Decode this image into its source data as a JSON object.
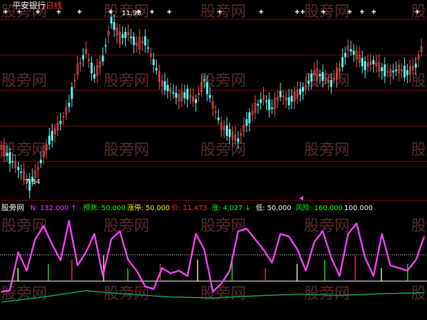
{
  "header": {
    "stock_name": "平安银行",
    "period": "日线",
    "name_color": "#ffffff",
    "period_color": "#ff3333"
  },
  "watermark": {
    "text": "股旁网",
    "color": "#5a2a2a"
  },
  "price_panel": {
    "high_label": "11.98",
    "low_label": "7.34",
    "grid_color": "#8b0000",
    "up_color": "#ff5252",
    "down_color": "#54fcfc"
  },
  "indicator_panel": {
    "name": "股旁网",
    "readout": [
      {
        "label": "N:",
        "value": "132.000",
        "arrow": "↑",
        "color": "#ff40ff"
      },
      {
        "label": "预测:",
        "value": "50.000",
        "arrow": "",
        "color": "#00ff00"
      },
      {
        "label": "涨停:",
        "value": "50.000",
        "arrow": "",
        "color": "#ffff00"
      },
      {
        "label": "价:",
        "value": "11.473",
        "arrow": "",
        "color": "#ff3030"
      },
      {
        "label": "涨:",
        "value": "4.027",
        "arrow": "↓",
        "color": "#00ff00"
      },
      {
        "label": "低:",
        "value": "50.000",
        "arrow": "",
        "color": "#ffffff"
      },
      {
        "label": "风险:",
        "value": "160.000",
        "arrow": "",
        "color": "#00ff00"
      },
      {
        "label": "",
        "value": "100.000",
        "arrow": "",
        "color": "#ffffff"
      }
    ]
  },
  "chart_data": {
    "type": "line",
    "price": {
      "ylim": [
        7.0,
        12.2
      ],
      "series": [
        {
          "x": 0,
          "y": 8.4
        },
        {
          "x": 4,
          "y": 8.0
        },
        {
          "x": 8,
          "y": 7.6
        },
        {
          "x": 10,
          "y": 7.34
        },
        {
          "x": 13,
          "y": 7.8
        },
        {
          "x": 17,
          "y": 8.6
        },
        {
          "x": 21,
          "y": 9.1
        },
        {
          "x": 24,
          "y": 9.6
        },
        {
          "x": 27,
          "y": 10.6
        },
        {
          "x": 30,
          "y": 11.1
        },
        {
          "x": 33,
          "y": 10.4
        },
        {
          "x": 36,
          "y": 10.9
        },
        {
          "x": 39,
          "y": 11.98
        },
        {
          "x": 42,
          "y": 11.5
        },
        {
          "x": 45,
          "y": 11.6
        },
        {
          "x": 48,
          "y": 11.3
        },
        {
          "x": 51,
          "y": 11.4
        },
        {
          "x": 54,
          "y": 10.8
        },
        {
          "x": 57,
          "y": 10.2
        },
        {
          "x": 60,
          "y": 10.0
        },
        {
          "x": 63,
          "y": 9.8
        },
        {
          "x": 66,
          "y": 9.9
        },
        {
          "x": 69,
          "y": 9.7
        },
        {
          "x": 72,
          "y": 10.3
        },
        {
          "x": 75,
          "y": 9.6
        },
        {
          "x": 78,
          "y": 9.0
        },
        {
          "x": 81,
          "y": 8.8
        },
        {
          "x": 84,
          "y": 8.6
        },
        {
          "x": 87,
          "y": 9.1
        },
        {
          "x": 90,
          "y": 9.5
        },
        {
          "x": 93,
          "y": 9.8
        },
        {
          "x": 96,
          "y": 9.5
        },
        {
          "x": 99,
          "y": 9.9
        },
        {
          "x": 102,
          "y": 9.7
        },
        {
          "x": 105,
          "y": 9.9
        },
        {
          "x": 108,
          "y": 10.1
        },
        {
          "x": 111,
          "y": 10.5
        },
        {
          "x": 114,
          "y": 10.4
        },
        {
          "x": 117,
          "y": 10.2
        },
        {
          "x": 120,
          "y": 10.6
        },
        {
          "x": 123,
          "y": 11.2
        },
        {
          "x": 126,
          "y": 11.0
        },
        {
          "x": 129,
          "y": 10.7
        },
        {
          "x": 132,
          "y": 10.8
        },
        {
          "x": 135,
          "y": 10.6
        },
        {
          "x": 138,
          "y": 10.5
        },
        {
          "x": 141,
          "y": 10.6
        },
        {
          "x": 144,
          "y": 10.5
        },
        {
          "x": 147,
          "y": 10.7
        },
        {
          "x": 150,
          "y": 11.4
        }
      ]
    },
    "indicator": {
      "ylim": [
        -20,
        180
      ],
      "reference_lines": [
        50,
        100
      ],
      "series": [
        {
          "x": 0,
          "y": 30
        },
        {
          "x": 3,
          "y": 32
        },
        {
          "x": 6,
          "y": 105
        },
        {
          "x": 9,
          "y": 70
        },
        {
          "x": 12,
          "y": 130
        },
        {
          "x": 15,
          "y": 155
        },
        {
          "x": 18,
          "y": 120
        },
        {
          "x": 21,
          "y": 90
        },
        {
          "x": 24,
          "y": 165
        },
        {
          "x": 27,
          "y": 80
        },
        {
          "x": 30,
          "y": 105
        },
        {
          "x": 33,
          "y": 140
        },
        {
          "x": 36,
          "y": 60
        },
        {
          "x": 39,
          "y": 130
        },
        {
          "x": 42,
          "y": 145
        },
        {
          "x": 45,
          "y": 90
        },
        {
          "x": 48,
          "y": 70
        },
        {
          "x": 51,
          "y": 40
        },
        {
          "x": 54,
          "y": 35
        },
        {
          "x": 57,
          "y": 75
        },
        {
          "x": 60,
          "y": 65
        },
        {
          "x": 63,
          "y": 70
        },
        {
          "x": 66,
          "y": 60
        },
        {
          "x": 69,
          "y": 140
        },
        {
          "x": 72,
          "y": 110
        },
        {
          "x": 75,
          "y": 30
        },
        {
          "x": 78,
          "y": 45
        },
        {
          "x": 81,
          "y": 70
        },
        {
          "x": 84,
          "y": 145
        },
        {
          "x": 87,
          "y": 150
        },
        {
          "x": 90,
          "y": 130
        },
        {
          "x": 93,
          "y": 110
        },
        {
          "x": 96,
          "y": 85
        },
        {
          "x": 99,
          "y": 140
        },
        {
          "x": 102,
          "y": 135
        },
        {
          "x": 105,
          "y": 110
        },
        {
          "x": 108,
          "y": 70
        },
        {
          "x": 111,
          "y": 125
        },
        {
          "x": 114,
          "y": 145
        },
        {
          "x": 117,
          "y": 95
        },
        {
          "x": 120,
          "y": 60
        },
        {
          "x": 123,
          "y": 140
        },
        {
          "x": 126,
          "y": 160
        },
        {
          "x": 129,
          "y": 95
        },
        {
          "x": 132,
          "y": 60
        },
        {
          "x": 135,
          "y": 140
        },
        {
          "x": 138,
          "y": 80
        },
        {
          "x": 141,
          "y": 75
        },
        {
          "x": 144,
          "y": 70
        },
        {
          "x": 147,
          "y": 90
        },
        {
          "x": 150,
          "y": 135
        }
      ]
    },
    "trend": {
      "series": [
        {
          "x": 0,
          "y": 10
        },
        {
          "x": 15,
          "y": 20
        },
        {
          "x": 30,
          "y": 32
        },
        {
          "x": 45,
          "y": 25
        },
        {
          "x": 60,
          "y": 20
        },
        {
          "x": 75,
          "y": 18
        },
        {
          "x": 90,
          "y": 22
        },
        {
          "x": 105,
          "y": 25
        },
        {
          "x": 120,
          "y": 23
        },
        {
          "x": 135,
          "y": 26
        },
        {
          "x": 150,
          "y": 28
        }
      ]
    }
  }
}
